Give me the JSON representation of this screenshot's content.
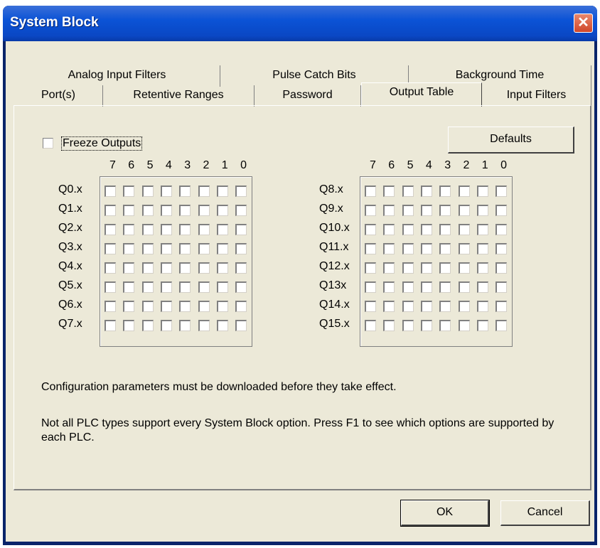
{
  "window": {
    "title": "System Block"
  },
  "tabs_row1": [
    "Analog Input Filters",
    "Pulse Catch Bits",
    "Background Time"
  ],
  "tabs_row2": [
    "Port(s)",
    "Retentive Ranges",
    "Password",
    "Output Table",
    "Input Filters"
  ],
  "active_tab": "Output Table",
  "freeze": {
    "label": "Freeze Outputs",
    "checked": false
  },
  "defaults_label": "Defaults",
  "bit_headers": [
    "7",
    "6",
    "5",
    "4",
    "3",
    "2",
    "1",
    "0"
  ],
  "left_rows": [
    "Q0.x",
    "Q1.x",
    "Q2.x",
    "Q3.x",
    "Q4.x",
    "Q5.x",
    "Q6.x",
    "Q7.x"
  ],
  "right_rows": [
    "Q8.x",
    "Q9.x",
    "Q10.x",
    "Q11.x",
    "Q12.x",
    "Q13x",
    "Q14.x",
    "Q15.x"
  ],
  "info": {
    "line1": "Configuration parameters must be downloaded before they take effect.",
    "line2": "Not all PLC types support every System Block option.  Press F1 to see which options are supported by each PLC."
  },
  "buttons": {
    "ok": "OK",
    "cancel": "Cancel"
  },
  "icons": {
    "close": "close-icon"
  }
}
